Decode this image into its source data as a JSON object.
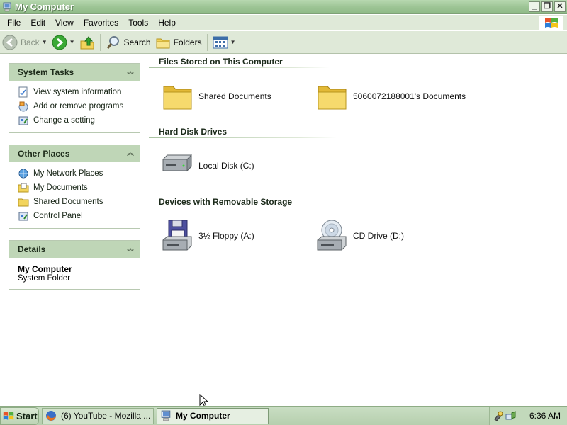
{
  "window": {
    "title": "My Computer"
  },
  "menu": [
    "File",
    "Edit",
    "View",
    "Favorites",
    "Tools",
    "Help"
  ],
  "toolbar": {
    "back_label": "Back",
    "search_label": "Search",
    "folders_label": "Folders"
  },
  "sidebar": {
    "system_tasks": {
      "title": "System Tasks",
      "items": [
        "View system information",
        "Add or remove programs",
        "Change a setting"
      ]
    },
    "other_places": {
      "title": "Other Places",
      "items": [
        "My Network Places",
        "My Documents",
        "Shared Documents",
        "Control Panel"
      ]
    },
    "details": {
      "title": "Details",
      "name": "My Computer",
      "type": "System Folder"
    }
  },
  "groups": {
    "files_stored": {
      "title": "Files Stored on This Computer",
      "items": [
        "Shared Documents",
        "5060072188001's Documents"
      ]
    },
    "hard_disks": {
      "title": "Hard Disk Drives",
      "items": [
        "Local Disk (C:)"
      ]
    },
    "removable": {
      "title": "Devices with Removable Storage",
      "items": [
        "3½ Floppy (A:)",
        "CD Drive (D:)"
      ]
    }
  },
  "taskbar": {
    "start_label": "Start",
    "tasks": [
      "(6) YouTube - Mozilla ...",
      "My Computer"
    ],
    "clock": "6:36 AM"
  },
  "colors": {
    "titlebar": "#9ec596",
    "panel_header": "#bfd6b7",
    "chrome": "#dfe9d8"
  }
}
